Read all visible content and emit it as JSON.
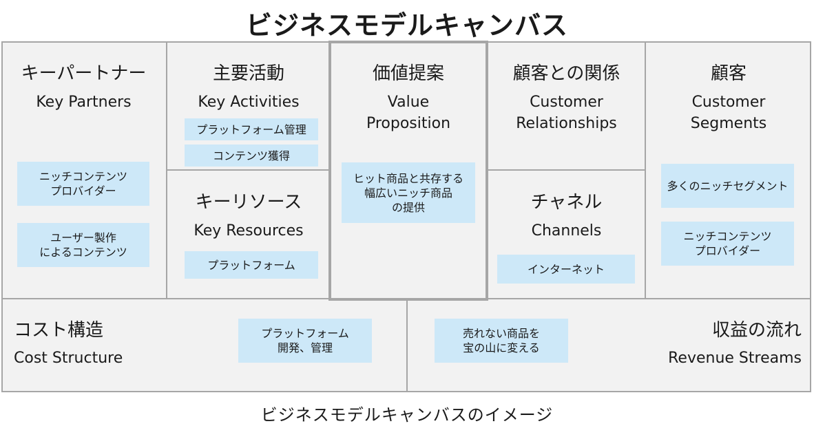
{
  "title": "ビジネスモデルキャンバス",
  "caption": "ビジネスモデルキャンバスのイメージ",
  "blocks": {
    "key_partners": {
      "jp": "キーパートナー",
      "en": "Key Partners",
      "notes": [
        "ニッチコンテンツ\nプロバイダー",
        "ユーザー製作\nによるコンテンツ"
      ]
    },
    "key_activities": {
      "jp": "主要活動",
      "en": "Key Activities",
      "notes": [
        "プラットフォーム管理",
        "コンテンツ獲得"
      ]
    },
    "key_resources": {
      "jp": "キーリソース",
      "en": "Key Resources",
      "notes": [
        "プラットフォーム"
      ]
    },
    "value_proposition": {
      "jp": "価値提案",
      "en": "Value\nProposition",
      "notes": [
        "ヒット商品と共存する\n幅広いニッチ商品\nの提供"
      ]
    },
    "customer_relationships": {
      "jp": "顧客との関係",
      "en": "Customer\nRelationships",
      "notes": []
    },
    "channels": {
      "jp": "チャネル",
      "en": "Channels",
      "notes": [
        "インターネット"
      ]
    },
    "customer_segments": {
      "jp": "顧客",
      "en": "Customer\nSegments",
      "notes": [
        "多くのニッチセグメント",
        "ニッチコンテンツ\nプロバイダー"
      ]
    },
    "cost_structure": {
      "jp": "コスト構造",
      "en": "Cost Structure",
      "notes": [
        "プラットフォーム\n開発、管理"
      ]
    },
    "revenue_streams": {
      "jp": "収益の流れ",
      "en": "Revenue Streams",
      "notes": [
        "売れない商品を\n宝の山に変える"
      ]
    }
  },
  "colors": {
    "note_fill": "#cde8f8",
    "border": "#a6a6a6",
    "cell_fill": "#f2f2f2"
  }
}
